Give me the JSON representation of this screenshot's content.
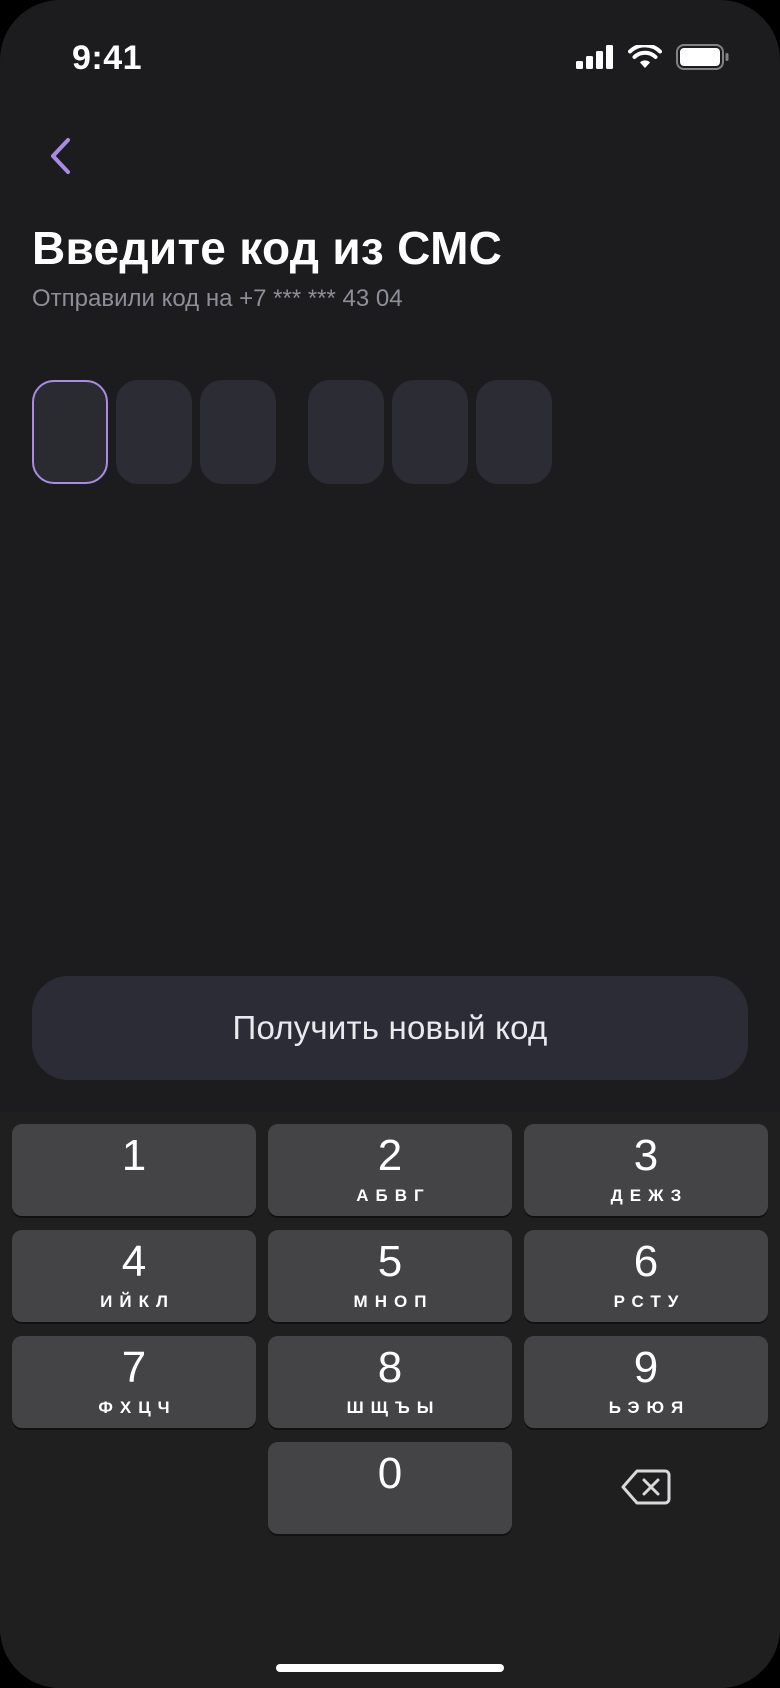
{
  "status_bar": {
    "time": "9:41",
    "icons": [
      "cellular-signal-icon",
      "wifi-icon",
      "battery-icon"
    ]
  },
  "header": {
    "back_icon": "chevron-left-icon",
    "title": "Введите код из СМС",
    "subtitle": "Отправили код на +7 *** *** 43 04"
  },
  "code_input": {
    "length": 6,
    "active_index": 0,
    "values": [
      "",
      "",
      "",
      "",
      "",
      ""
    ]
  },
  "actions": {
    "new_code_label": "Получить новый код"
  },
  "keypad": {
    "keys": [
      {
        "digit": "1",
        "letters": ""
      },
      {
        "digit": "2",
        "letters": "АБВГ"
      },
      {
        "digit": "3",
        "letters": "ДЕЖЗ"
      },
      {
        "digit": "4",
        "letters": "ИЙКЛ"
      },
      {
        "digit": "5",
        "letters": "МНОП"
      },
      {
        "digit": "6",
        "letters": "РСТУ"
      },
      {
        "digit": "7",
        "letters": "ФХЦЧ"
      },
      {
        "digit": "8",
        "letters": "ШЩЪЫ"
      },
      {
        "digit": "9",
        "letters": "ЬЭЮЯ"
      },
      {
        "digit": "0",
        "letters": ""
      }
    ],
    "delete_icon": "backspace-icon"
  },
  "colors": {
    "background": "#1c1c1e",
    "accent": "#a98be6",
    "code_box": "#2c2c34",
    "button": "#2c2c37",
    "key": "#444446",
    "subtitle": "#8e8e99"
  }
}
